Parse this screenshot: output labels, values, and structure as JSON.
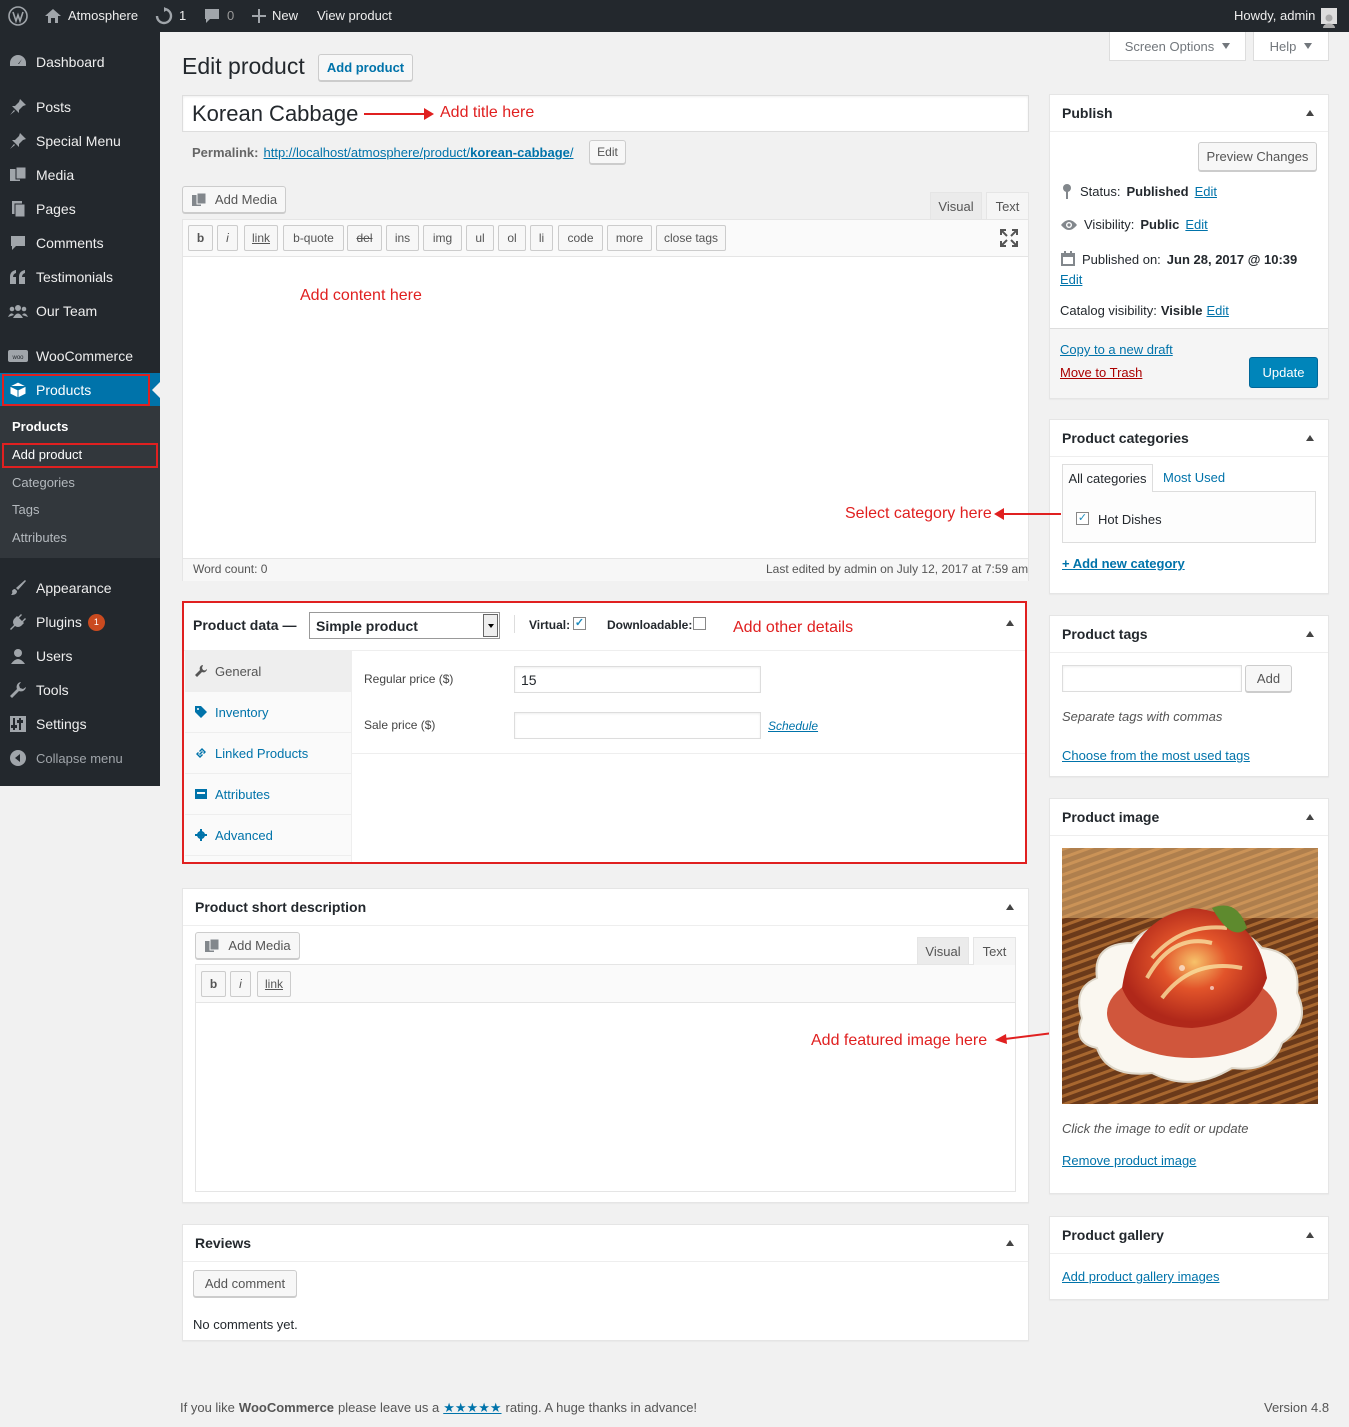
{
  "adminbar": {
    "site_name": "Atmosphere",
    "updates_count": "1",
    "comments_count": "0",
    "new_label": "New",
    "view_label": "View product",
    "howdy": "Howdy, admin"
  },
  "sidebar": {
    "dashboard": "Dashboard",
    "posts": "Posts",
    "special_menu": "Special Menu",
    "media": "Media",
    "pages": "Pages",
    "comments": "Comments",
    "testimonials": "Testimonials",
    "our_team": "Our Team",
    "woocommerce": "WooCommerce",
    "products": "Products",
    "submenu": {
      "products": "Products",
      "add_product": "Add product",
      "categories": "Categories",
      "tags": "Tags",
      "attributes": "Attributes"
    },
    "appearance": "Appearance",
    "plugins": "Plugins",
    "plugins_badge": "1",
    "users": "Users",
    "tools": "Tools",
    "settings": "Settings",
    "collapse": "Collapse menu"
  },
  "screen_options": "Screen Options",
  "help": "Help",
  "page": {
    "title": "Edit product",
    "add_product_button": "Add product",
    "product_title": "Korean Cabbage",
    "permalink_label": "Permalink:",
    "permalink_base": "http://localhost/atmosphere/product/",
    "permalink_slug": "korean-cabbage",
    "permalink_end": "/",
    "permalink_edit": "Edit"
  },
  "editor": {
    "add_media": "Add Media",
    "tab_visual": "Visual",
    "tab_text": "Text",
    "quicktags": [
      "b",
      "i",
      "link",
      "b-quote",
      "del",
      "ins",
      "img",
      "ul",
      "ol",
      "li",
      "code",
      "more",
      "close tags"
    ],
    "word_count": "Word count: 0",
    "last_edited": "Last edited by admin on July 12, 2017 at 7:59 am"
  },
  "annotations": {
    "title": "Add title here",
    "content": "Add content here",
    "category": "Select category here",
    "details": "Add other details",
    "image": "Add featured image here"
  },
  "product_data": {
    "label": "Product data —",
    "type": "Simple product",
    "virtual_label": "Virtual:",
    "virtual_checked": true,
    "downloadable_label": "Downloadable:",
    "downloadable_checked": false,
    "tabs": [
      "General",
      "Inventory",
      "Linked Products",
      "Attributes",
      "Advanced"
    ],
    "regular_price_label": "Regular price ($)",
    "regular_price": "15",
    "sale_price_label": "Sale price ($)",
    "sale_price": "",
    "schedule": "Schedule"
  },
  "short_description": {
    "title": "Product short description",
    "add_media": "Add Media",
    "tab_visual": "Visual",
    "tab_text": "Text",
    "quicktags": [
      "b",
      "i",
      "link"
    ]
  },
  "reviews": {
    "title": "Reviews",
    "add_comment": "Add comment",
    "empty": "No comments yet."
  },
  "publish": {
    "title": "Publish",
    "preview": "Preview Changes",
    "status_label": "Status:",
    "status_value": "Published",
    "visibility_label": "Visibility:",
    "visibility_value": "Public",
    "published_label": "Published on:",
    "published_value": "Jun 28, 2017 @ 10:39",
    "catalog_label": "Catalog visibility:",
    "catalog_value": "Visible",
    "edit": "Edit",
    "copy_draft": "Copy to a new draft",
    "trash": "Move to Trash",
    "update": "Update"
  },
  "categories": {
    "title": "Product categories",
    "tab_all": "All categories",
    "tab_most_used": "Most Used",
    "item": "Hot Dishes",
    "item_checked": true,
    "add_new": "+ Add new category"
  },
  "tags": {
    "title": "Product tags",
    "add": "Add",
    "hint": "Separate tags with commas",
    "choose": "Choose from the most used tags"
  },
  "product_image": {
    "title": "Product image",
    "hint": "Click the image to edit or update",
    "remove": "Remove product image"
  },
  "gallery": {
    "title": "Product gallery",
    "add": "Add product gallery images"
  },
  "footer": {
    "prefix": "If you like",
    "brand": "WooCommerce",
    "middle": "please leave us a",
    "stars": "★★★★★",
    "suffix": "rating. A huge thanks in advance!",
    "version": "Version 4.8"
  },
  "colors": {
    "admin_dark": "#23282d",
    "accent": "#0073aa",
    "annotation_red": "#e02020"
  }
}
